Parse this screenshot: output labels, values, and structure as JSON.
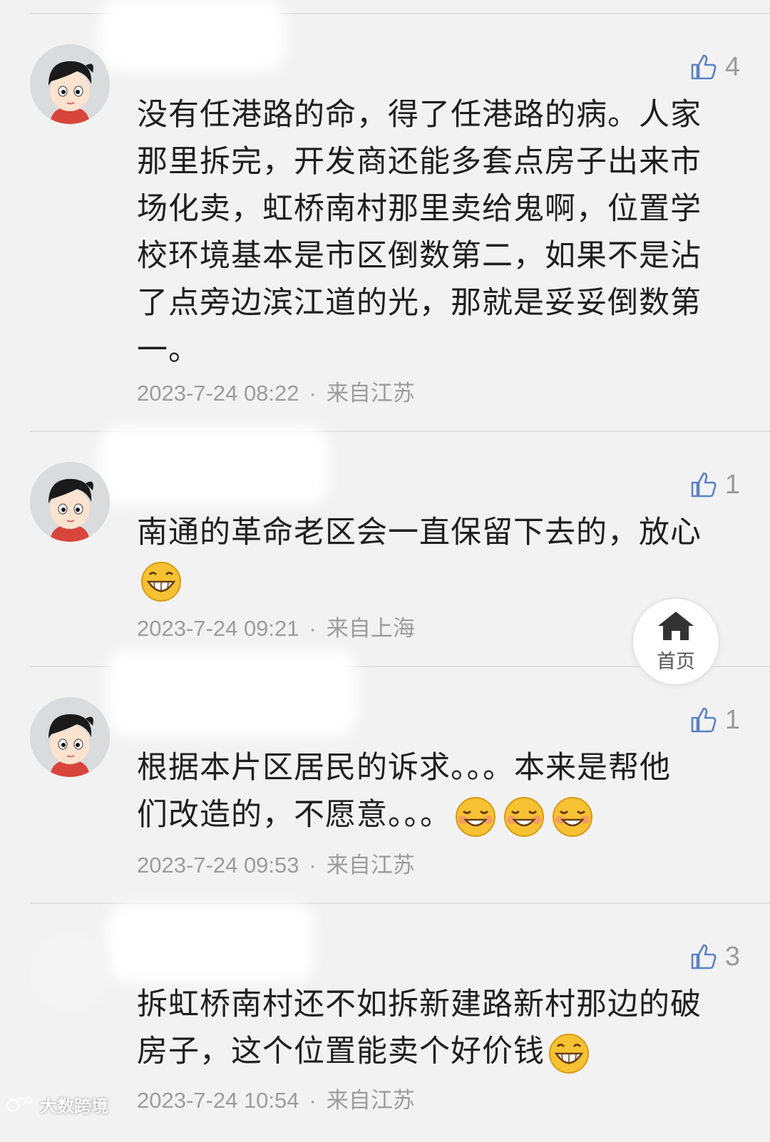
{
  "comments": [
    {
      "likes": "4",
      "text_lines": [
        "没有任港路的命，得了任港路的病。人家",
        "那里拆完，开发商还能多套点房子出来市",
        "场化卖，虹桥南村那里卖给鬼啊，位置学",
        "校环境基本是市区倒数第二，如果不是沾",
        "了点旁边滨江道的光，那就是妥妥倒数第",
        "一。"
      ],
      "time": "2023-7-24 08:22",
      "location": "来自江苏"
    },
    {
      "likes": "1",
      "text_lines": [
        "南通的革命老区会一直保留下去的，放心"
      ],
      "time": "2023-7-24 09:21",
      "location": "来自上海"
    },
    {
      "likes": "1",
      "text_lines": [
        "根据本片区居民的诉求。。。本来是帮他",
        "们改造的，不愿意。。。"
      ],
      "time": "2023-7-24 09:53",
      "location": "来自江苏"
    },
    {
      "likes": "3",
      "text_lines": [
        "拆虹桥南村还不如拆新建路新村那边的破",
        "房子，这个位置能卖个好价钱"
      ],
      "time": "2023-7-24 10:54",
      "location": "来自江苏"
    }
  ],
  "separator": "·",
  "home_button": {
    "label": "首页",
    "icon": "home-icon"
  },
  "watermark": {
    "text": "大数跨境"
  },
  "colors": {
    "background": "#f2f2f2",
    "like_icon": "#5a82c4",
    "meta_text": "#9c9c9c",
    "body_text": "#1f1f1f"
  }
}
